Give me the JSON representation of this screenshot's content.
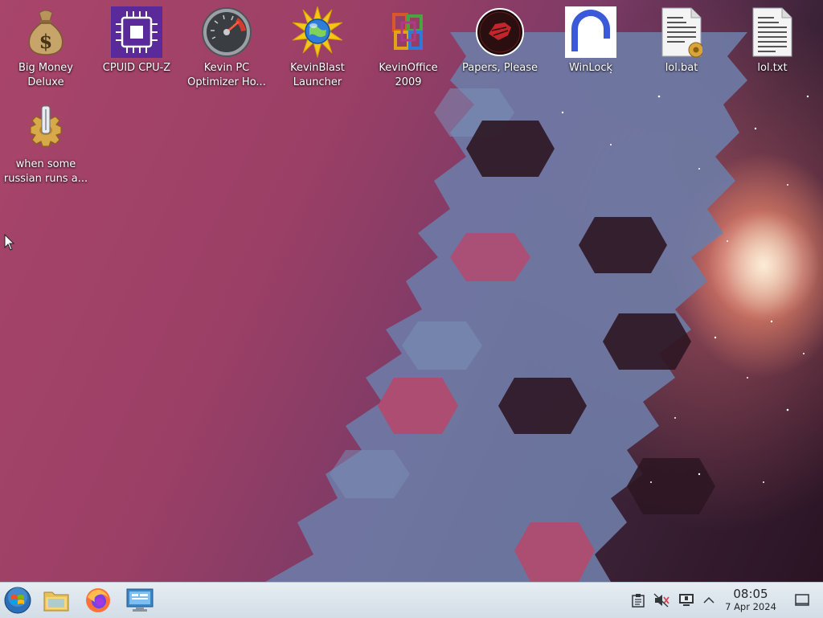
{
  "desktop": {
    "icons": [
      {
        "label": "Big Money\nDeluxe",
        "icon": "money-bag-icon"
      },
      {
        "label": "CPUID CPU-Z",
        "icon": "cpu-chip-icon"
      },
      {
        "label": "Kevin PC\nOptimizer Ho...",
        "icon": "speedometer-icon"
      },
      {
        "label": "KevinBlast\nLauncher",
        "icon": "globe-burst-icon"
      },
      {
        "label": "KevinOffice\n2009",
        "icon": "office-logo-icon"
      },
      {
        "label": "Papers, Please",
        "icon": "papers-please-seal-icon"
      },
      {
        "label": "WinLock",
        "icon": "winlock-icon"
      },
      {
        "label": "lol.bat",
        "icon": "batch-file-icon"
      },
      {
        "label": "lol.txt",
        "icon": "text-file-icon"
      },
      {
        "label": "when some\nrussian runs a...",
        "icon": "gear-script-icon"
      }
    ]
  },
  "taskbar": {
    "buttons": [
      {
        "name": "start-menu-button",
        "icon": "windows-orb-icon"
      },
      {
        "name": "file-manager-button",
        "icon": "folder-icon"
      },
      {
        "name": "firefox-button",
        "icon": "firefox-icon"
      },
      {
        "name": "system-settings-button",
        "icon": "monitor-settings-icon"
      }
    ],
    "tray": {
      "icons": [
        "clipboard-icon",
        "volume-muted-icon",
        "display-icon",
        "chevron-up-icon",
        "show-desktop-icon"
      ]
    },
    "clock": {
      "time": "08:05",
      "date": "7 Apr 2024"
    }
  },
  "colors": {
    "taskbar_bg": "#dfe7ee",
    "wallpaper_pink": "#a9456a",
    "wallpaper_blue": "#6f7ea6",
    "wallpaper_dark": "#2a1424"
  }
}
